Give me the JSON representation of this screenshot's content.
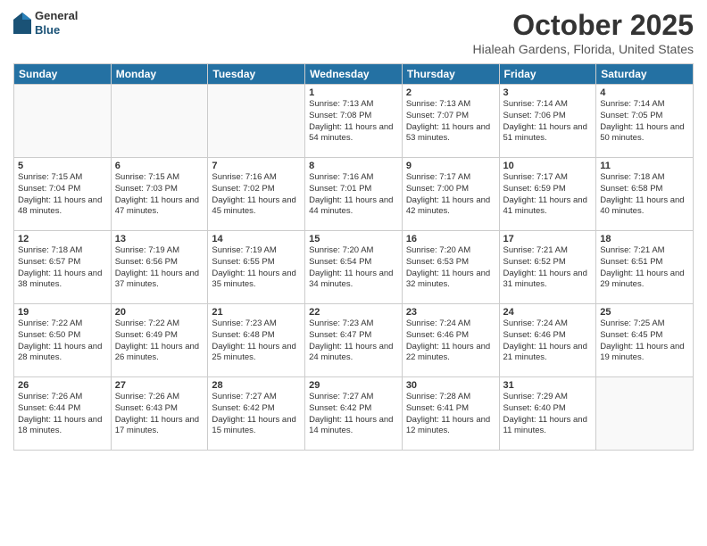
{
  "app": {
    "name_general": "General",
    "name_blue": "Blue"
  },
  "header": {
    "month": "October 2025",
    "location": "Hialeah Gardens, Florida, United States"
  },
  "days_of_week": [
    "Sunday",
    "Monday",
    "Tuesday",
    "Wednesday",
    "Thursday",
    "Friday",
    "Saturday"
  ],
  "weeks": [
    [
      {
        "day": "",
        "content": ""
      },
      {
        "day": "",
        "content": ""
      },
      {
        "day": "",
        "content": ""
      },
      {
        "day": "1",
        "content": "Sunrise: 7:13 AM\nSunset: 7:08 PM\nDaylight: 11 hours\nand 54 minutes."
      },
      {
        "day": "2",
        "content": "Sunrise: 7:13 AM\nSunset: 7:07 PM\nDaylight: 11 hours\nand 53 minutes."
      },
      {
        "day": "3",
        "content": "Sunrise: 7:14 AM\nSunset: 7:06 PM\nDaylight: 11 hours\nand 51 minutes."
      },
      {
        "day": "4",
        "content": "Sunrise: 7:14 AM\nSunset: 7:05 PM\nDaylight: 11 hours\nand 50 minutes."
      }
    ],
    [
      {
        "day": "5",
        "content": "Sunrise: 7:15 AM\nSunset: 7:04 PM\nDaylight: 11 hours\nand 48 minutes."
      },
      {
        "day": "6",
        "content": "Sunrise: 7:15 AM\nSunset: 7:03 PM\nDaylight: 11 hours\nand 47 minutes."
      },
      {
        "day": "7",
        "content": "Sunrise: 7:16 AM\nSunset: 7:02 PM\nDaylight: 11 hours\nand 45 minutes."
      },
      {
        "day": "8",
        "content": "Sunrise: 7:16 AM\nSunset: 7:01 PM\nDaylight: 11 hours\nand 44 minutes."
      },
      {
        "day": "9",
        "content": "Sunrise: 7:17 AM\nSunset: 7:00 PM\nDaylight: 11 hours\nand 42 minutes."
      },
      {
        "day": "10",
        "content": "Sunrise: 7:17 AM\nSunset: 6:59 PM\nDaylight: 11 hours\nand 41 minutes."
      },
      {
        "day": "11",
        "content": "Sunrise: 7:18 AM\nSunset: 6:58 PM\nDaylight: 11 hours\nand 40 minutes."
      }
    ],
    [
      {
        "day": "12",
        "content": "Sunrise: 7:18 AM\nSunset: 6:57 PM\nDaylight: 11 hours\nand 38 minutes."
      },
      {
        "day": "13",
        "content": "Sunrise: 7:19 AM\nSunset: 6:56 PM\nDaylight: 11 hours\nand 37 minutes."
      },
      {
        "day": "14",
        "content": "Sunrise: 7:19 AM\nSunset: 6:55 PM\nDaylight: 11 hours\nand 35 minutes."
      },
      {
        "day": "15",
        "content": "Sunrise: 7:20 AM\nSunset: 6:54 PM\nDaylight: 11 hours\nand 34 minutes."
      },
      {
        "day": "16",
        "content": "Sunrise: 7:20 AM\nSunset: 6:53 PM\nDaylight: 11 hours\nand 32 minutes."
      },
      {
        "day": "17",
        "content": "Sunrise: 7:21 AM\nSunset: 6:52 PM\nDaylight: 11 hours\nand 31 minutes."
      },
      {
        "day": "18",
        "content": "Sunrise: 7:21 AM\nSunset: 6:51 PM\nDaylight: 11 hours\nand 29 minutes."
      }
    ],
    [
      {
        "day": "19",
        "content": "Sunrise: 7:22 AM\nSunset: 6:50 PM\nDaylight: 11 hours\nand 28 minutes."
      },
      {
        "day": "20",
        "content": "Sunrise: 7:22 AM\nSunset: 6:49 PM\nDaylight: 11 hours\nand 26 minutes."
      },
      {
        "day": "21",
        "content": "Sunrise: 7:23 AM\nSunset: 6:48 PM\nDaylight: 11 hours\nand 25 minutes."
      },
      {
        "day": "22",
        "content": "Sunrise: 7:23 AM\nSunset: 6:47 PM\nDaylight: 11 hours\nand 24 minutes."
      },
      {
        "day": "23",
        "content": "Sunrise: 7:24 AM\nSunset: 6:46 PM\nDaylight: 11 hours\nand 22 minutes."
      },
      {
        "day": "24",
        "content": "Sunrise: 7:24 AM\nSunset: 6:46 PM\nDaylight: 11 hours\nand 21 minutes."
      },
      {
        "day": "25",
        "content": "Sunrise: 7:25 AM\nSunset: 6:45 PM\nDaylight: 11 hours\nand 19 minutes."
      }
    ],
    [
      {
        "day": "26",
        "content": "Sunrise: 7:26 AM\nSunset: 6:44 PM\nDaylight: 11 hours\nand 18 minutes."
      },
      {
        "day": "27",
        "content": "Sunrise: 7:26 AM\nSunset: 6:43 PM\nDaylight: 11 hours\nand 17 minutes."
      },
      {
        "day": "28",
        "content": "Sunrise: 7:27 AM\nSunset: 6:42 PM\nDaylight: 11 hours\nand 15 minutes."
      },
      {
        "day": "29",
        "content": "Sunrise: 7:27 AM\nSunset: 6:42 PM\nDaylight: 11 hours\nand 14 minutes."
      },
      {
        "day": "30",
        "content": "Sunrise: 7:28 AM\nSunset: 6:41 PM\nDaylight: 11 hours\nand 12 minutes."
      },
      {
        "day": "31",
        "content": "Sunrise: 7:29 AM\nSunset: 6:40 PM\nDaylight: 11 hours\nand 11 minutes."
      },
      {
        "day": "",
        "content": ""
      }
    ]
  ]
}
